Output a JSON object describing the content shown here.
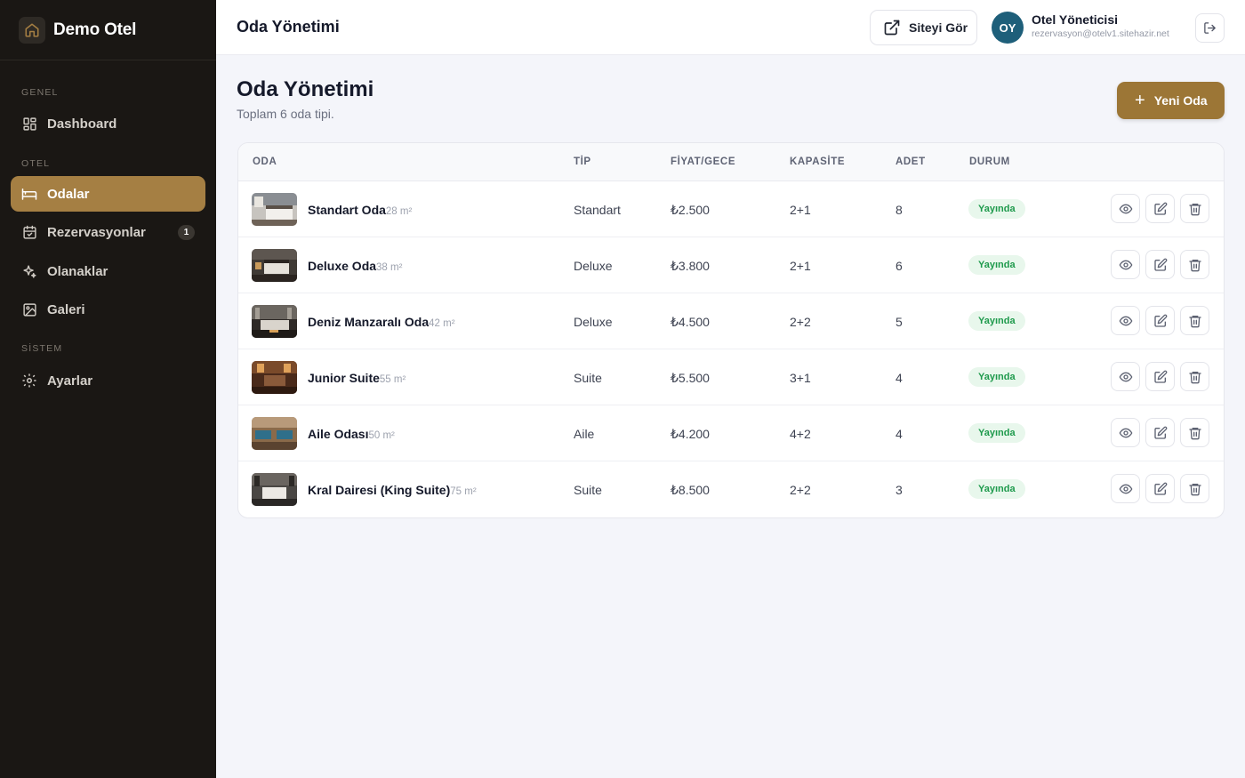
{
  "brand": {
    "name": "Demo Otel",
    "logo_icon": "home-icon"
  },
  "sidebar": {
    "sections": [
      {
        "label": "GENEL"
      },
      {
        "label": "OTEL"
      },
      {
        "label": "SİSTEM"
      }
    ],
    "items": [
      {
        "label": "Dashboard",
        "icon": "dashboard-icon",
        "active": false
      },
      {
        "label": "Odalar",
        "icon": "bed-icon",
        "active": true
      },
      {
        "label": "Rezervasyonlar",
        "icon": "calendar-icon",
        "active": false,
        "badge": "1"
      },
      {
        "label": "Olanaklar",
        "icon": "sparkles-icon",
        "active": false
      },
      {
        "label": "Galeri",
        "icon": "image-icon",
        "active": false
      },
      {
        "label": "Ayarlar",
        "icon": "gear-icon",
        "active": false
      }
    ]
  },
  "header": {
    "title": "Oda Yönetimi",
    "site_button": "Siteyi Gör",
    "user": {
      "initials": "OY",
      "name": "Otel Yöneticisi",
      "email": "rezervasyon@otelv1.sitehazir.net"
    }
  },
  "page": {
    "title": "Oda Yönetimi",
    "subtitle": "Toplam 6 oda tipi.",
    "new_button": "Yeni Oda"
  },
  "table": {
    "columns": [
      "ODA",
      "TİP",
      "FİYAT/GECE",
      "KAPASİTE",
      "ADET",
      "DURUM"
    ],
    "rows": [
      {
        "name": "Standart Oda",
        "size": "28 m²",
        "type": "Standart",
        "price": "₺2.500",
        "capacity": "2+1",
        "count": "8",
        "status": "Yayında"
      },
      {
        "name": "Deluxe Oda",
        "size": "38 m²",
        "type": "Deluxe",
        "price": "₺3.800",
        "capacity": "2+1",
        "count": "6",
        "status": "Yayında"
      },
      {
        "name": "Deniz Manzaralı Oda",
        "size": "42 m²",
        "type": "Deluxe",
        "price": "₺4.500",
        "capacity": "2+2",
        "count": "5",
        "status": "Yayında"
      },
      {
        "name": "Junior Suite",
        "size": "55 m²",
        "type": "Suite",
        "price": "₺5.500",
        "capacity": "3+1",
        "count": "4",
        "status": "Yayında"
      },
      {
        "name": "Aile Odası",
        "size": "50 m²",
        "type": "Aile",
        "price": "₺4.200",
        "capacity": "4+2",
        "count": "4",
        "status": "Yayında"
      },
      {
        "name": "Kral Dairesi (King Suite)",
        "size": "75 m²",
        "type": "Suite",
        "price": "₺8.500",
        "capacity": "2+2",
        "count": "3",
        "status": "Yayında"
      }
    ]
  },
  "colors": {
    "sidebar_bg": "#1a1714",
    "accent": "#a57f43",
    "primary_button": "#9c7636",
    "avatar": "#1e5f7a",
    "status_green": "#1e9a4c",
    "status_green_bg": "#e8f7ec"
  }
}
